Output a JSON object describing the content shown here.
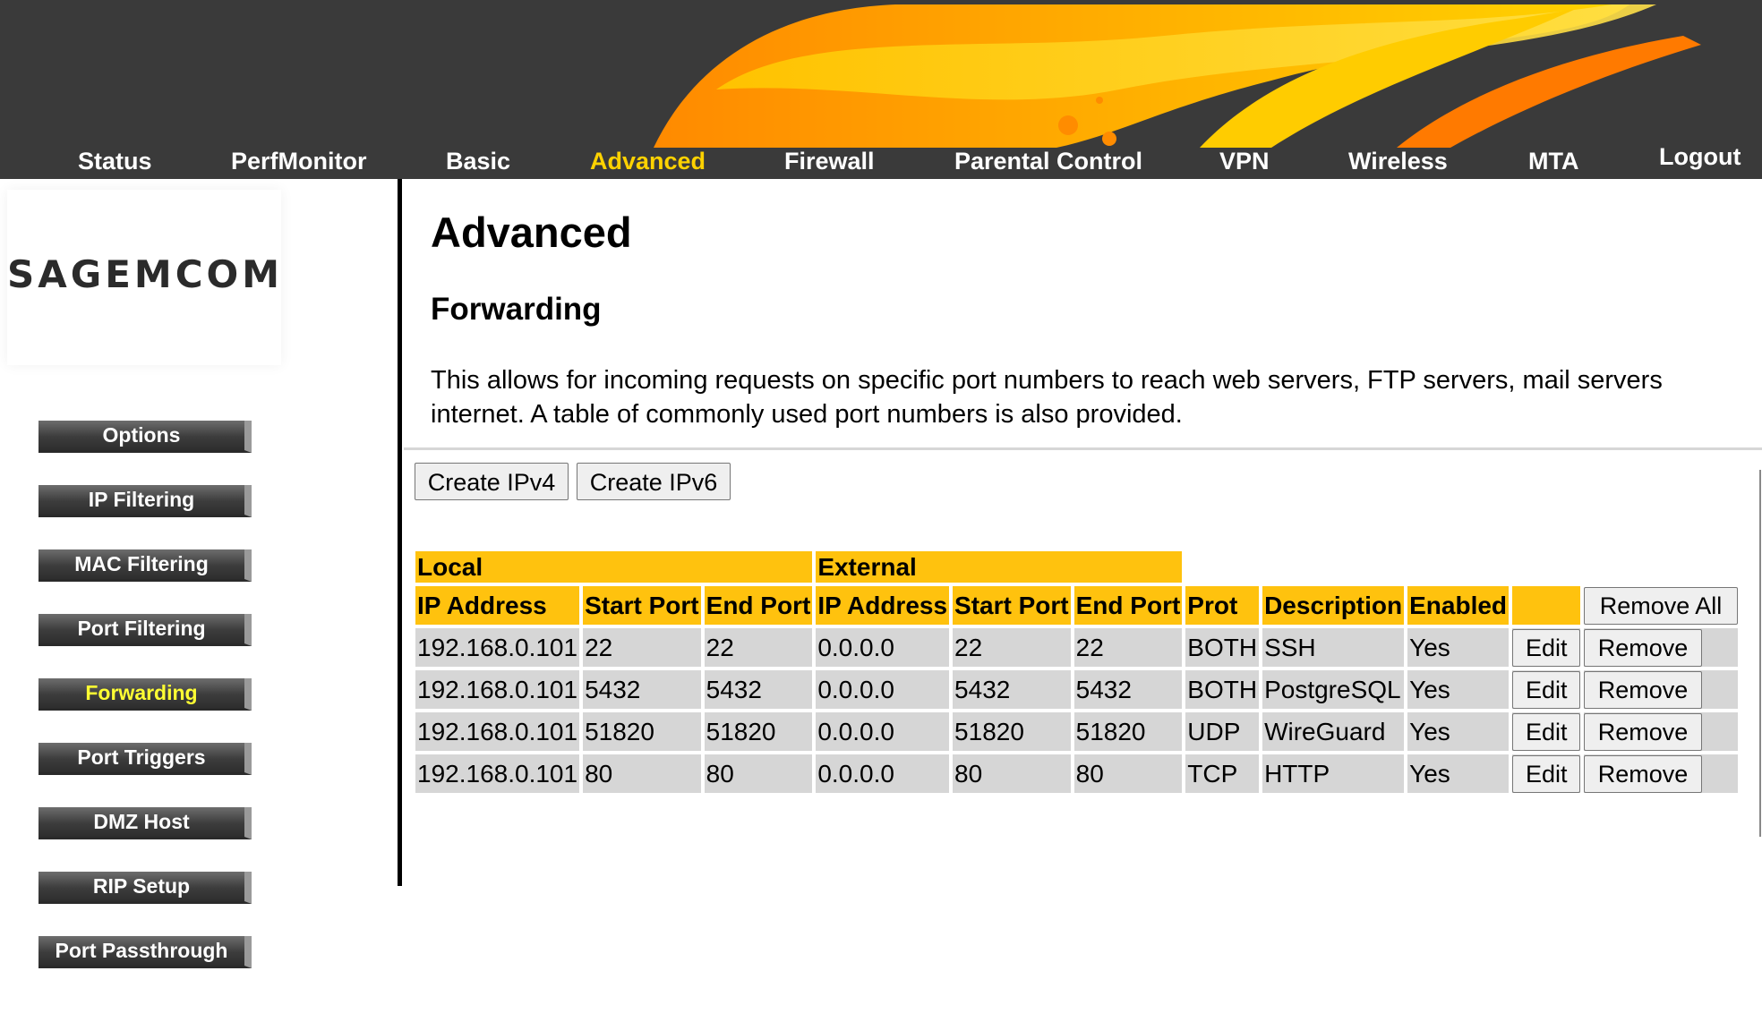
{
  "topnav": [
    {
      "label": "Status",
      "active": false
    },
    {
      "label": "PerfMonitor",
      "active": false
    },
    {
      "label": "Basic",
      "active": false
    },
    {
      "label": "Advanced",
      "active": true
    },
    {
      "label": "Firewall",
      "active": false
    },
    {
      "label": "Parental Control",
      "active": false
    },
    {
      "label": "VPN",
      "active": false
    },
    {
      "label": "Wireless",
      "active": false
    },
    {
      "label": "MTA",
      "active": false
    },
    {
      "label": "Logout",
      "active": false
    }
  ],
  "brand": {
    "logo_text": "SAGEMCOM"
  },
  "sidebar": [
    {
      "label": "Options",
      "active": false
    },
    {
      "label": "IP Filtering",
      "active": false
    },
    {
      "label": "MAC Filtering",
      "active": false
    },
    {
      "label": "Port Filtering",
      "active": false
    },
    {
      "label": "Forwarding",
      "active": true
    },
    {
      "label": "Port Triggers",
      "active": false
    },
    {
      "label": "DMZ Host",
      "active": false
    },
    {
      "label": "RIP Setup",
      "active": false
    },
    {
      "label": "Port Passthrough",
      "active": false
    }
  ],
  "main": {
    "title": "Advanced",
    "section": "Forwarding",
    "description_line1": "This allows for incoming requests on specific port numbers to reach web servers, FTP servers, mail servers",
    "description_line2": "internet. A table of commonly used port numbers is also provided.",
    "create_ipv4": "Create IPv4",
    "create_ipv6": "Create IPv6"
  },
  "table": {
    "group_local": "Local",
    "group_external": "External",
    "headers": [
      "IP Address",
      "Start Port",
      "End Port",
      "IP Address",
      "Start Port",
      "End Port",
      "Prot",
      "Description",
      "Enabled"
    ],
    "remove_all": "Remove All",
    "edit_label": "Edit",
    "remove_label": "Remove",
    "rows": [
      [
        "192.168.0.101",
        "22",
        "22",
        "0.0.0.0",
        "22",
        "22",
        "BOTH",
        "SSH",
        "Yes"
      ],
      [
        "192.168.0.101",
        "5432",
        "5432",
        "0.0.0.0",
        "5432",
        "5432",
        "BOTH",
        "PostgreSQL",
        "Yes"
      ],
      [
        "192.168.0.101",
        "51820",
        "51820",
        "0.0.0.0",
        "51820",
        "51820",
        "UDP",
        "WireGuard",
        "Yes"
      ],
      [
        "192.168.0.101",
        "80",
        "80",
        "0.0.0.0",
        "80",
        "80",
        "TCP",
        "HTTP",
        "Yes"
      ]
    ]
  },
  "colors": {
    "header_bg": "#3a3a3a",
    "active_nav": "#ffd200",
    "table_header": "#ffc20e",
    "table_cell": "#d6d6d6",
    "active_sidebar": "#ffff33"
  }
}
